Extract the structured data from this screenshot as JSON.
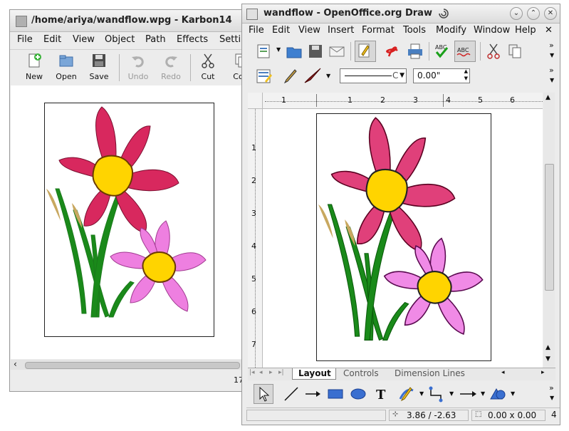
{
  "karbon": {
    "title": "/home/ariya/wandflow.wpg - Karbon14",
    "menu": [
      "File",
      "Edit",
      "View",
      "Object",
      "Path",
      "Effects",
      "Setti"
    ],
    "toolbar": [
      "New",
      "Open",
      "Save",
      "Undo",
      "Redo",
      "Cut",
      "Cop"
    ],
    "status_zoom": "17"
  },
  "draw": {
    "title": "wandflow - OpenOffice.org Draw",
    "menu": [
      "File",
      "Edit",
      "View",
      "Insert",
      "Format",
      "Tools",
      "Modify",
      "Window",
      "Help"
    ],
    "line_width": "0.00\"",
    "line_style_suffix": "C",
    "ruler_h": [
      "1",
      "1",
      "2",
      "3",
      "4",
      "5",
      "6"
    ],
    "ruler_v": [
      "1",
      "2",
      "3",
      "4",
      "5",
      "6",
      "7"
    ],
    "tabs": [
      "Layout",
      "Controls",
      "Dimension Lines"
    ],
    "status_position": "3.86 / -2.63",
    "status_size": "0.00 x 0.00",
    "status_extra": "4"
  },
  "colors": {
    "petal_red": "#d8285e",
    "petal_pink": "#ee7fe0",
    "center": "#ffd400",
    "stem": "#1a7a1a"
  }
}
